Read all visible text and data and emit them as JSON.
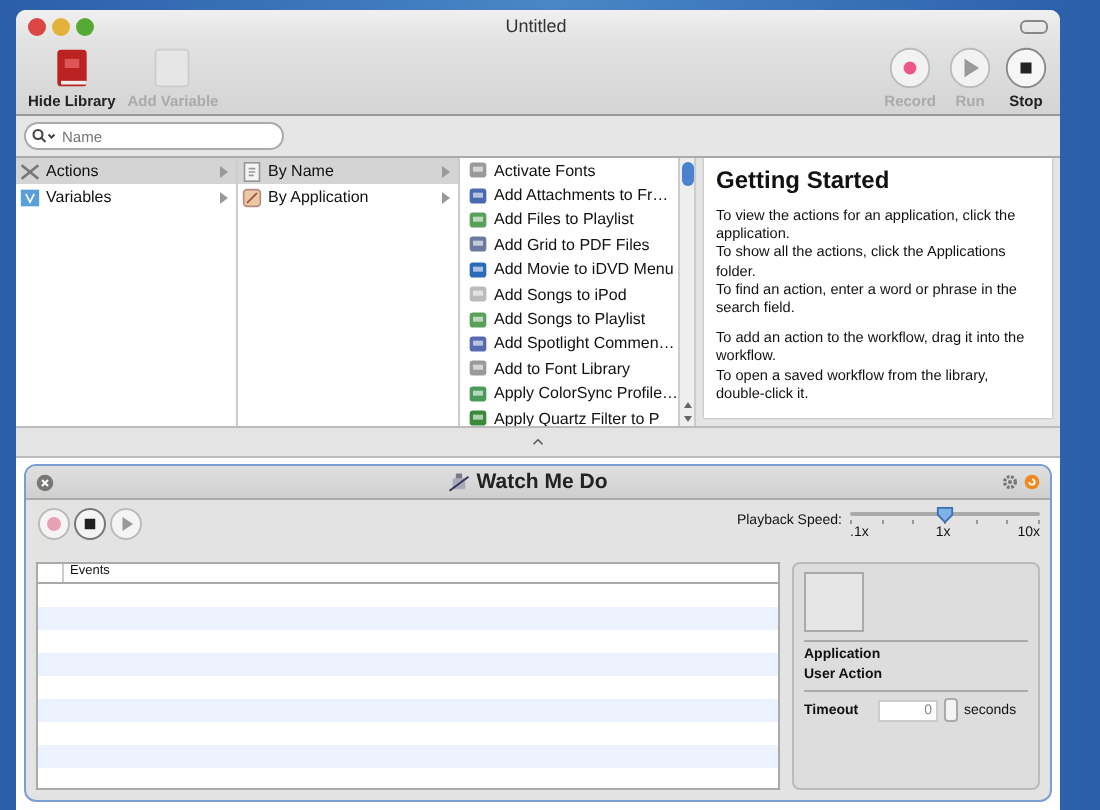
{
  "window": {
    "title": "Untitled"
  },
  "toolbar": {
    "left": [
      {
        "label": "Hide Library",
        "kind": "library",
        "disabled": false
      },
      {
        "label": "Add Variable",
        "kind": "variable",
        "disabled": true
      }
    ],
    "right": [
      {
        "label": "Record",
        "kind": "record",
        "disabled": true
      },
      {
        "label": "Run",
        "kind": "run",
        "disabled": true
      },
      {
        "label": "Stop",
        "kind": "stop",
        "disabled": false
      }
    ]
  },
  "search": {
    "placeholder": "Name"
  },
  "library": {
    "categories": [
      {
        "label": "Actions",
        "kind": "actions",
        "selected": true
      },
      {
        "label": "Variables",
        "kind": "variables",
        "selected": false
      }
    ],
    "groups": [
      {
        "label": "By Name",
        "kind": "name",
        "selected": true
      },
      {
        "label": "By Application",
        "kind": "application",
        "selected": false
      }
    ],
    "actions": [
      "Activate Fonts",
      "Add Attachments to Fr…",
      "Add Files to Playlist",
      "Add Grid to PDF Files",
      "Add Movie to iDVD Menu",
      "Add Songs to iPod",
      "Add Songs to Playlist",
      "Add Spotlight Commen…",
      "Add to Font Library",
      "Apply ColorSync Profile…",
      "Apply Quartz Filter to P"
    ]
  },
  "description": {
    "title": "Getting Started",
    "paragraphs": [
      [
        "To view the actions for an application, click the application.",
        "To show all the actions, click the Applications folder.",
        "To find an action, enter a word or phrase in the search field."
      ],
      [
        "To add an action to the workflow, drag it into the workflow.",
        "To open a saved workflow from the library, double-click it."
      ]
    ]
  },
  "action": {
    "title": "Watch Me Do",
    "controls": [
      {
        "kind": "record",
        "disabled": true
      },
      {
        "kind": "stop",
        "disabled": false
      },
      {
        "kind": "play",
        "disabled": true
      }
    ],
    "playback": {
      "label": "Playback Speed:",
      "level": 0.5,
      "ticks": [
        ".1x",
        "1x",
        "10x"
      ]
    },
    "events": {
      "column": "Events"
    },
    "info": {
      "labels": [
        "Application",
        "User Action"
      ],
      "timeout_label": "Timeout",
      "timeout_value": "0",
      "timeout_unit": "seconds"
    }
  }
}
